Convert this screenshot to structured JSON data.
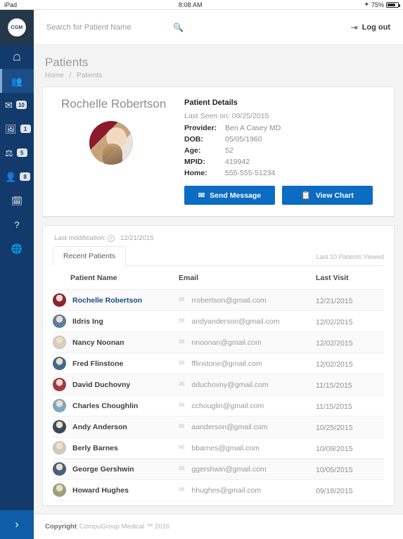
{
  "statusbar": {
    "device": "iPad",
    "time": "8:08 AM",
    "battery_pct": "75%",
    "bluetooth_icon": "bluetooth-icon"
  },
  "sidebar": {
    "logo_text": "CGM",
    "items": [
      {
        "icon": "home-icon",
        "glyph": "⌂",
        "badge": ""
      },
      {
        "icon": "patients-icon",
        "glyph": "♚",
        "badge": ""
      },
      {
        "icon": "mail-icon",
        "glyph": "✉",
        "badge": "10"
      },
      {
        "icon": "image-icon",
        "glyph": "⛰",
        "badge": "1"
      },
      {
        "icon": "lab-icon",
        "glyph": "⚗",
        "badge": "5"
      },
      {
        "icon": "user-icon",
        "glyph": "♟",
        "badge": "8"
      },
      {
        "icon": "calendar-icon",
        "glyph": "Ὄ5",
        "badge": ""
      },
      {
        "icon": "help-icon",
        "glyph": "?",
        "badge": ""
      },
      {
        "icon": "globe-icon",
        "glyph": "⊕",
        "badge": ""
      }
    ],
    "expand_label": "›"
  },
  "topbar": {
    "search_placeholder": "Search for Patient Name",
    "search_value": "",
    "search_icon": "search-icon",
    "logout_label": "Log out",
    "logout_icon": "logout-icon"
  },
  "page": {
    "title": "Patients",
    "breadcrumb_home": "Home",
    "breadcrumb_sep": "/",
    "breadcrumb_current": "Patients"
  },
  "patient_detail": {
    "name": "Rochelle Robertson",
    "section_title": "Patient Details",
    "last_seen": "Last Seen on: 09/25/2015",
    "fields": [
      {
        "label": "Provider:",
        "value": "Ben A Casey MD"
      },
      {
        "label": "DOB:",
        "value": "05/05/1960"
      },
      {
        "label": "Age:",
        "value": "52"
      },
      {
        "label": "MPID:",
        "value": "419942"
      },
      {
        "label": "Home:",
        "value": "555-555-51234"
      }
    ],
    "send_message_label": "Send Message",
    "view_chart_label": "View Chart"
  },
  "recent": {
    "last_modification_label": "Last modification:",
    "last_modification_date": "12/21/2015",
    "tab_label": "Recent Patients",
    "note": "Last 10 Patients Viewed",
    "columns": [
      "Patient Name",
      "Email",
      "Last Visit"
    ],
    "rows": [
      {
        "name": "Rochelle Robertson",
        "email": "rrobertson@gmail.com",
        "visit": "12/21/2015",
        "avatar": "#8d2234",
        "current": true
      },
      {
        "name": "Ildris Ing",
        "email": "andyanderson@gmail.com",
        "visit": "12/02/2015",
        "avatar": "#5b7f9e",
        "current": false
      },
      {
        "name": "Nancy Noonan",
        "email": "nnoonan@gmail.com",
        "visit": "12/02/2015",
        "avatar": "#d8cdbe",
        "current": false
      },
      {
        "name": "Fred Flinstone",
        "email": "fflinstone@gmail.com",
        "visit": "12/02/2015",
        "avatar": "#46688a",
        "current": false
      },
      {
        "name": "David Duchovny",
        "email": "dduchovny@gmail.com",
        "visit": "11/15/2015",
        "avatar": "#a23a46",
        "current": false
      },
      {
        "name": "Charles Choughlin",
        "email": "cchouglin@gmail.com",
        "visit": "11/15/2015",
        "avatar": "#7fa8c6",
        "current": false
      },
      {
        "name": "Andy Anderson",
        "email": "aanderson@gmail.com",
        "visit": "10/25/2015",
        "avatar": "#3b4a5a",
        "current": false
      },
      {
        "name": "Berly Barnes",
        "email": "bbarnes@gmail.com",
        "visit": "10/09/2015",
        "avatar": "#cfcabf",
        "current": false
      },
      {
        "name": "George Gershwin",
        "email": "ggershwin@gmail.com",
        "visit": "10/05/2015",
        "avatar": "#44617c",
        "current": false
      },
      {
        "name": "Howard Hughes",
        "email": "hhughes@gmail.com",
        "visit": "09/18/2015",
        "avatar": "#9aa37f",
        "current": false
      }
    ],
    "mail_icon": "mail-icon"
  },
  "footer": {
    "copyright_label": "Copyright",
    "copyright_text": "CompuGroup Medical ™  2016"
  },
  "colors": {
    "sidebar": "#123a6b",
    "sidebar_header": "#25374b",
    "accent_button": "#0b6cc4",
    "expand_button": "#0f5ca8",
    "link": "#174a8c"
  }
}
